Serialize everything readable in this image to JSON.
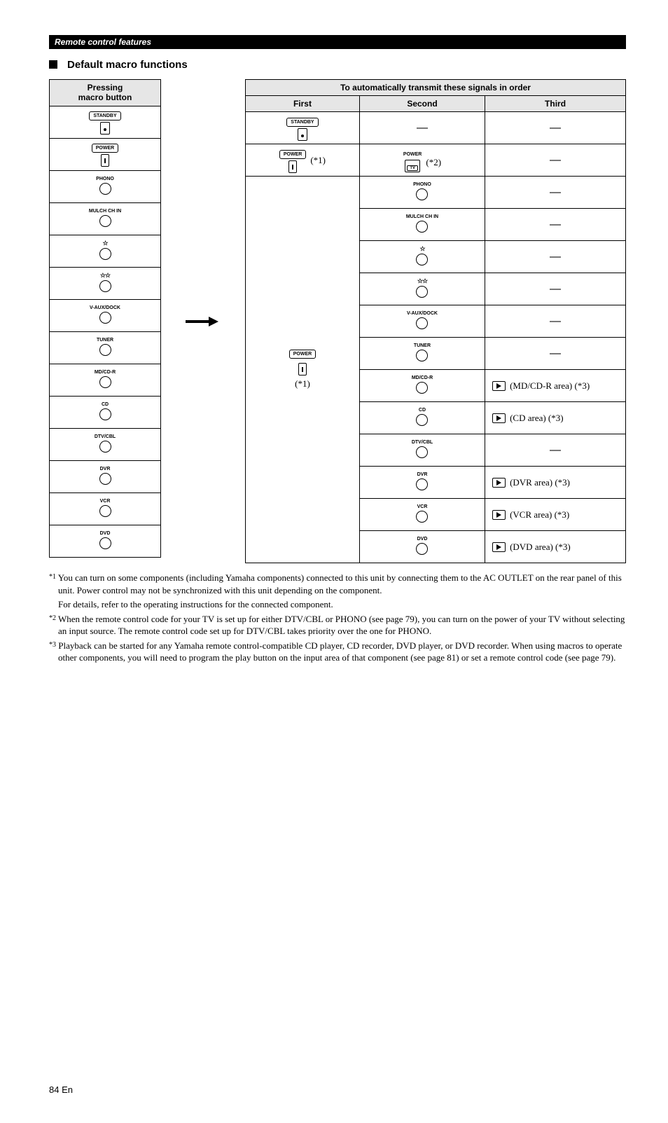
{
  "header": {
    "bar": "Remote control features"
  },
  "section": {
    "title": "Default macro functions"
  },
  "table_headers": {
    "pressing": "Pressing\nmacro button",
    "order": "To automatically transmit these signals in order",
    "first": "First",
    "second": "Second",
    "third": "Third"
  },
  "labels": {
    "standby": "STANDBY",
    "power": "POWER",
    "power_s": "POWER",
    "phono": "PHONO",
    "multi": "MULCH CH IN",
    "vaux": "V-AUX/DOCK",
    "tuner": "TUNER",
    "mdcdr": "MD/CD-R",
    "cd": "CD",
    "dtvcbl": "DTV/CBL",
    "dvr": "DVR",
    "vcr": "VCR",
    "dvd": "DVD",
    "tv": "TV"
  },
  "ann": {
    "s1": "(*1)",
    "s2": "(*2)",
    "s3": "(*3)"
  },
  "third": {
    "mdcdr": "(MD/CD-R area) (*3)",
    "cd": "(CD area) (*3)",
    "dvr": "(DVR area) (*3)",
    "vcr": "(VCR area) (*3)",
    "dvd": "(DVD area) (*3)"
  },
  "notes": {
    "n1a": "You can turn on some components (including Yamaha components) connected to this unit by connecting them to the AC OUTLET on the rear panel of this unit. Power control may not be synchronized with this unit depending on the component.",
    "n1b": "For details, refer to the operating instructions for the connected component.",
    "n2": "When the remote control code for your TV is set up for either DTV/CBL or PHONO (see page 79), you can turn on the power of your TV without selecting an input source. The remote control code set up for DTV/CBL takes priority over the one for PHONO.",
    "n3": "Playback can be started for any Yamaha remote control-compatible CD player, CD recorder, DVD player, or DVD recorder. When using macros to operate other components, you will need to program the play button on the input area of that component (see page 81) or set a remote control code (see page 79)."
  },
  "sups": {
    "s1": "*1",
    "s2": "*2",
    "s3": "*3"
  },
  "page": {
    "num": "84",
    "suf": "En"
  }
}
